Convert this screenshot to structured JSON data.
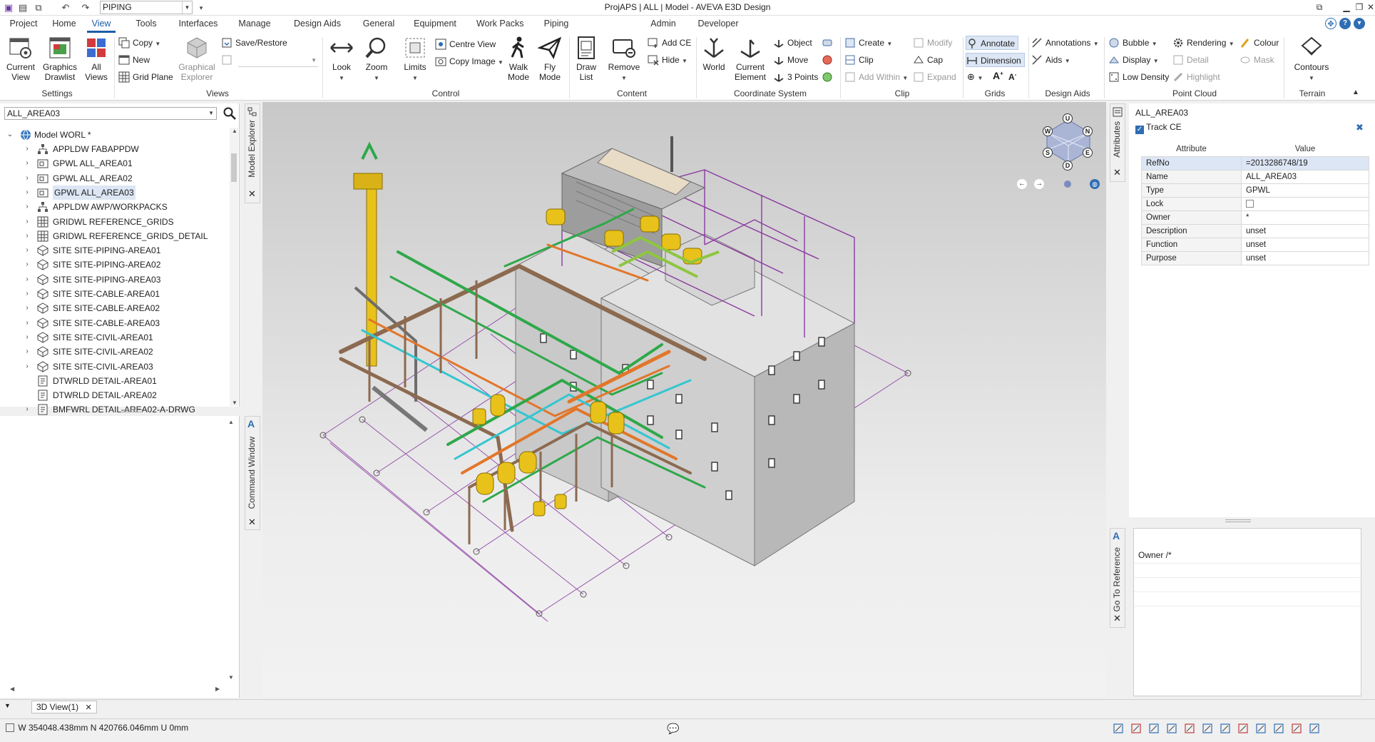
{
  "titlebar": {
    "module": "PIPING",
    "title": "ProjAPS | ALL | Model - AVEVA E3D Design"
  },
  "tabs": [
    {
      "label": "Project"
    },
    {
      "label": "Home"
    },
    {
      "label": "View",
      "active": true
    },
    {
      "label": "Tools"
    },
    {
      "label": "Interfaces"
    },
    {
      "label": "Manage"
    },
    {
      "label": "Design Aids"
    },
    {
      "label": "General"
    },
    {
      "label": "Equipment"
    },
    {
      "label": "Work Packs"
    },
    {
      "label": "Piping"
    },
    {
      "label": "Admin"
    },
    {
      "label": "Developer"
    }
  ],
  "ribbon": {
    "settings": {
      "current_view": "Current View",
      "graphics_drawlist": "Graphics Drawlist",
      "all_views": "All Views",
      "label": "Settings"
    },
    "views": {
      "copy": "Copy",
      "new": "New",
      "grid_plane": "Grid Plane",
      "graphical_explorer": "Graphical Explorer",
      "save_restore": "Save/Restore",
      "label": "Views"
    },
    "control": {
      "look": "Look",
      "zoom": "Zoom",
      "limits": "Limits",
      "centre_view": "Centre View",
      "copy_image": "Copy Image",
      "walk_mode": "Walk Mode",
      "fly_mode": "Fly Mode",
      "label": "Control"
    },
    "content": {
      "draw_list": "Draw List",
      "remove": "Remove",
      "add_ce": "Add CE",
      "hide": "Hide",
      "label": "Content"
    },
    "coord": {
      "world": "World",
      "current_element": "Current Element",
      "object": "Object",
      "move": "Move",
      "three_points": "3 Points",
      "label": "Coordinate System"
    },
    "clip": {
      "create": "Create",
      "clip": "Clip",
      "add_within": "Add Within",
      "modify": "Modify",
      "cap": "Cap",
      "expand": "Expand",
      "label": "Clip"
    },
    "grids": {
      "annotate": "Annotate",
      "dimension": "Dimension",
      "label": "Grids"
    },
    "design_aids": {
      "annotations": "Annotations",
      "aids": "Aids",
      "label": "Design Aids"
    },
    "point_cloud": {
      "bubble": "Bubble",
      "display": "Display",
      "low_density": "Low Density",
      "rendering": "Rendering",
      "detail": "Detail",
      "highlight": "Highlight",
      "colour": "Colour",
      "mask": "Mask",
      "label": "Point Cloud"
    },
    "terrain": {
      "contours": "Contours",
      "label": "Terrain"
    }
  },
  "explorer": {
    "search_value": "ALL_AREA03",
    "side_label": "Model Explorer",
    "root": "Model WORL *",
    "items": [
      {
        "label": "APPLDW FABAPPDW",
        "icon": "hierarchy"
      },
      {
        "label": "GPWL ALL_AREA01",
        "icon": "group"
      },
      {
        "label": "GPWL ALL_AREA02",
        "icon": "group"
      },
      {
        "label": "GPWL ALL_AREA03",
        "icon": "group",
        "selected": true
      },
      {
        "label": "APPLDW AWP/WORKPACKS",
        "icon": "hierarchy"
      },
      {
        "label": "GRIDWL REFERENCE_GRIDS",
        "icon": "grid"
      },
      {
        "label": "GRIDWL REFERENCE_GRIDS_DETAIL",
        "icon": "grid"
      },
      {
        "label": "SITE SITE-PIPING-AREA01",
        "icon": "site"
      },
      {
        "label": "SITE SITE-PIPING-AREA02",
        "icon": "site"
      },
      {
        "label": "SITE SITE-PIPING-AREA03",
        "icon": "site"
      },
      {
        "label": "SITE SITE-CABLE-AREA01",
        "icon": "site"
      },
      {
        "label": "SITE SITE-CABLE-AREA02",
        "icon": "site"
      },
      {
        "label": "SITE SITE-CABLE-AREA03",
        "icon": "site"
      },
      {
        "label": "SITE SITE-CIVIL-AREA01",
        "icon": "site"
      },
      {
        "label": "SITE SITE-CIVIL-AREA02",
        "icon": "site"
      },
      {
        "label": "SITE SITE-CIVIL-AREA03",
        "icon": "site"
      },
      {
        "label": "DTWRLD DETAIL-AREA01",
        "icon": "doc"
      },
      {
        "label": "DTWRLD DETAIL-AREA02",
        "icon": "doc"
      },
      {
        "label": "BMFWRL DETAIL-AREA02-A-DRWG",
        "icon": "doc"
      }
    ]
  },
  "command_window": {
    "side_label": "Command Window"
  },
  "attributes": {
    "side_label": "Attributes",
    "element": "ALL_AREA03",
    "track_ce": "Track CE",
    "header_attr": "Attribute",
    "header_value": "Value",
    "rows": [
      {
        "k": "RefNo",
        "v": "=2013286748/19",
        "sel": true
      },
      {
        "k": "Name",
        "v": "ALL_AREA03"
      },
      {
        "k": "Type",
        "v": "GPWL"
      },
      {
        "k": "Lock",
        "v": ""
      },
      {
        "k": "Owner",
        "v": "*"
      },
      {
        "k": "Description",
        "v": "unset"
      },
      {
        "k": "Function",
        "v": "unset"
      },
      {
        "k": "Purpose",
        "v": "unset"
      }
    ]
  },
  "goto_reference": {
    "side_label": "Go To Reference",
    "text": "Owner  /*"
  },
  "viewcube": {
    "u": "U",
    "n": "N",
    "e": "E",
    "d": "D",
    "s": "S",
    "w": "W"
  },
  "doc_tab": "3D View(1)",
  "status": {
    "coords": "W 354048.438mm N 420766.046mm U 0mm"
  },
  "colors": {
    "accent": "#1b5ea8",
    "pipe_green": "#2fa84a",
    "pipe_cyan": "#34c6d0",
    "pipe_orange": "#e2762a",
    "steel_yellow": "#e8c21a",
    "grid_purple": "#8a3aa0",
    "building_grey": "#c9c9c9"
  }
}
